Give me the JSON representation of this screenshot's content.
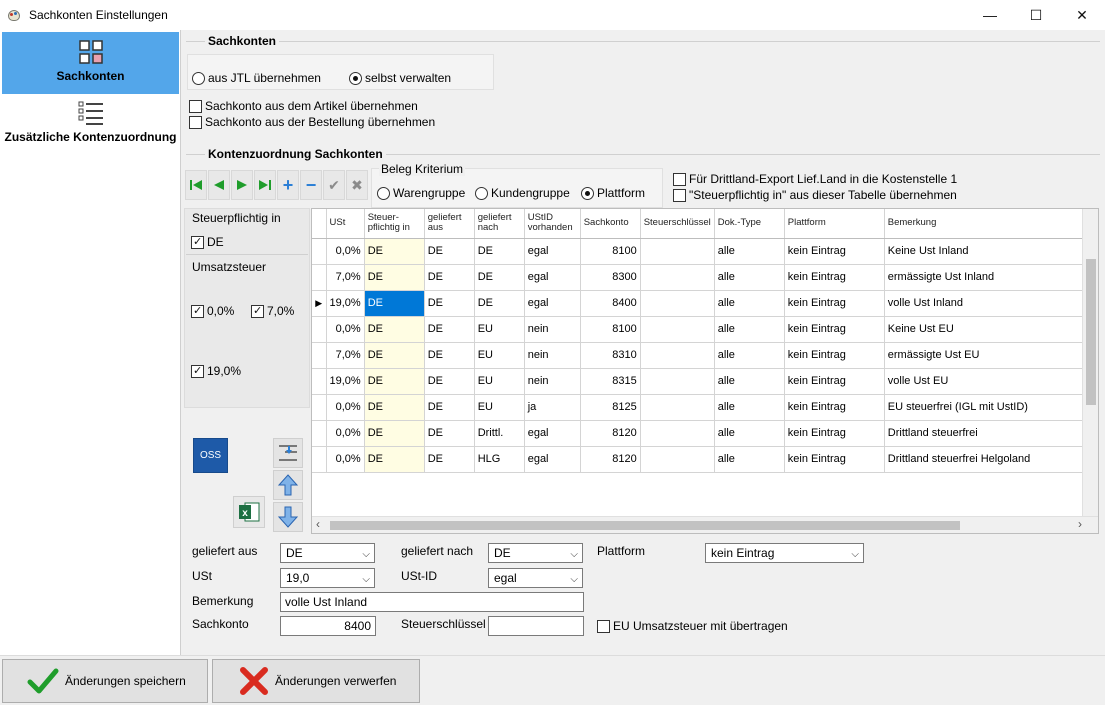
{
  "window": {
    "title": "Sachkonten Einstellungen",
    "minimize": "—",
    "maximize": "☐",
    "close": "✕"
  },
  "nav": [
    {
      "label": "Sachkonten",
      "icon": "grid-icon"
    },
    {
      "label": "Zusätzliche Kontenzuordnung",
      "icon": "list-icon"
    }
  ],
  "sachkonten": {
    "title": "Sachkonten",
    "radio_jtl": "aus JTL übernehmen",
    "radio_self": "selbst verwalten",
    "chk_artikel": "Sachkonto aus dem Artikel übernehmen",
    "chk_bestellung": "Sachkonto aus der Bestellung übernehmen"
  },
  "zuordnung": {
    "title": "Kontenzuordnung Sachkonten",
    "beleg_title": "Beleg Kriterium",
    "radio_waren": "Warengruppe",
    "radio_kunden": "Kundengruppe",
    "radio_plattform": "Plattform",
    "chk_drittland": "Für Drittland-Export Lief.Land in die Kostenstelle 1",
    "chk_steuerpflichtig": "\"Steuerpflichtig in\" aus dieser Tabelle übernehmen"
  },
  "side": {
    "steuer_title": "Steuerpflichtig in",
    "steuer_de": "DE",
    "ust_title": "Umsatzsteuer",
    "ust_0": "0,0%",
    "ust_7": "7,0%",
    "ust_19": "19,0%",
    "oss": "OSS"
  },
  "grid": {
    "headers": [
      "USt",
      "Steuer-\npflichtig in",
      "geliefert\naus",
      "geliefert\nnach",
      "UStID\nvorhanden",
      "Sachkonto",
      "Steuerschlüssel",
      "Dok.-Type",
      "Plattform",
      "Bemerkung"
    ],
    "rows": [
      [
        "0,0%",
        "DE",
        "DE",
        "DE",
        "egal",
        "8100",
        "",
        "alle",
        "kein Eintrag",
        "Keine Ust Inland"
      ],
      [
        "7,0%",
        "DE",
        "DE",
        "DE",
        "egal",
        "8300",
        "",
        "alle",
        "kein Eintrag",
        "ermässigte Ust Inland"
      ],
      [
        "19,0%",
        "DE",
        "DE",
        "DE",
        "egal",
        "8400",
        "",
        "alle",
        "kein Eintrag",
        "volle Ust Inland"
      ],
      [
        "0,0%",
        "DE",
        "DE",
        "EU",
        "nein",
        "8100",
        "",
        "alle",
        "kein Eintrag",
        "Keine Ust EU"
      ],
      [
        "7,0%",
        "DE",
        "DE",
        "EU",
        "nein",
        "8310",
        "",
        "alle",
        "kein Eintrag",
        "ermässigte Ust EU"
      ],
      [
        "19,0%",
        "DE",
        "DE",
        "EU",
        "nein",
        "8315",
        "",
        "alle",
        "kein Eintrag",
        "volle Ust EU"
      ],
      [
        "0,0%",
        "DE",
        "DE",
        "EU",
        "ja",
        "8125",
        "",
        "alle",
        "kein Eintrag",
        "EU steuerfrei (IGL mit UstID)"
      ],
      [
        "0,0%",
        "DE",
        "DE",
        "Drittl.",
        "egal",
        "8120",
        "",
        "alle",
        "kein Eintrag",
        "Drittland steuerfrei"
      ],
      [
        "0,0%",
        "DE",
        "DE",
        "HLG",
        "egal",
        "8120",
        "",
        "alle",
        "kein Eintrag",
        "Drittland steuerfrei Helgoland"
      ]
    ],
    "selected_row": 2
  },
  "form": {
    "geliefert_aus_label": "geliefert aus",
    "geliefert_aus_value": "DE",
    "geliefert_nach_label": "geliefert nach",
    "geliefert_nach_value": "DE",
    "plattform_label": "Plattform",
    "plattform_value": "kein Eintrag",
    "ust_label": "USt",
    "ust_value": "19,0",
    "ustid_label": "USt-ID",
    "ustid_value": "egal",
    "bemerkung_label": "Bemerkung",
    "bemerkung_value": "volle Ust Inland",
    "sachkonto_label": "Sachkonto",
    "sachkonto_value": "8400",
    "steuerschluessel_label": "Steuerschlüssel",
    "steuerschluessel_value": "",
    "eu_chk_label": "EU Umsatzsteuer mit übertragen"
  },
  "bottom": {
    "save": "Änderungen speichern",
    "discard": "Änderungen verwerfen"
  },
  "colors": {
    "accent": "#53a6ea",
    "selection": "#0078d7",
    "yellow_cell": "#fffde3",
    "green": "#1f9d2b",
    "red": "#d92b1f"
  }
}
